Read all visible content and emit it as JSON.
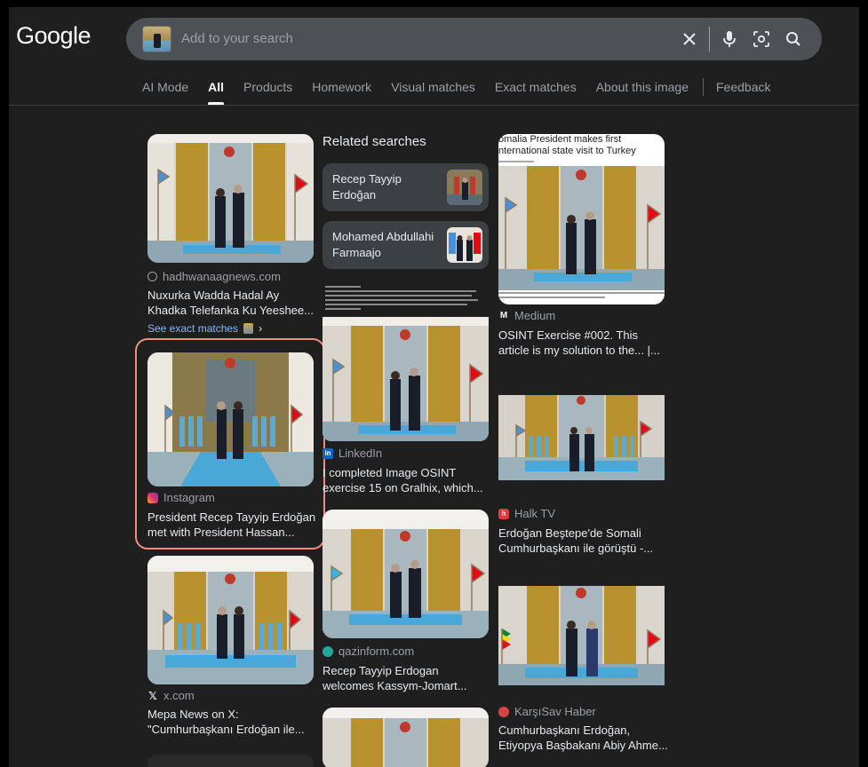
{
  "logo": "Google",
  "search": {
    "placeholder": "Add to your search"
  },
  "tabs": [
    "AI Mode",
    "All",
    "Products",
    "Homework",
    "Visual matches",
    "Exact matches",
    "About this image",
    "Feedback"
  ],
  "related": {
    "heading": "Related searches",
    "chips": [
      {
        "line1": "Recep Tayyip",
        "line2": "Erdoğan"
      },
      {
        "line1": "Mohamed Abdullahi",
        "line2": "Farmaajo"
      }
    ]
  },
  "cards": {
    "c1": {
      "site": "hadhwanaagnews.com",
      "t1": "Nuxurka Wadda Hadal Ay",
      "t2": "Khadka Telefanka Ku Yeeshee..."
    },
    "exact_matches": "See exact matches",
    "c2": {
      "site": "Instagram",
      "t1": "President Recep Tayyip Erdoğan",
      "t2": "met with President Hassan..."
    },
    "c3": {
      "site": "x.com",
      "t1": "Mepa News on X:",
      "t2": "\"Cumhurbaşkanı Erdoğan ile..."
    },
    "c4": {
      "site": "LinkedIn",
      "t1": "I completed Image OSINT",
      "t2": "exercise 15 on Gralhix, which..."
    },
    "c5": {
      "site": "qazinform.com",
      "t1": "Recep Tayyip Erdogan",
      "t2": "welcomes Kassym-Jomart..."
    },
    "c6": {
      "site": "Medium",
      "t1": "OSINT Exercise #002. This",
      "t2": "article is my solution to the... |...",
      "headline1": "omalia President makes first",
      "headline2": "nternational state visit to Turkey"
    },
    "c7": {
      "site": "Halk TV",
      "t1": "Erdoğan Beştepe'de Somali",
      "t2": "Cumhurbaşkanı ile görüştü -..."
    },
    "c8": {
      "site": "KarşıSav Haber",
      "t1": "Cumhurbaşkanı Erdoğan,",
      "t2": "Etiyopya Başbakanı Abiy Ahme..."
    }
  },
  "colors": {
    "background": "#1f1f1f",
    "link": "#8ab4f8",
    "highlight": "#f28b82",
    "carpet": "#4aa8d8",
    "gold": "#c9a65a"
  },
  "icons": [
    "clear-icon",
    "microphone-icon",
    "lens-icon",
    "search-icon",
    "globe-icon",
    "instagram-icon",
    "x-icon",
    "linkedin-icon",
    "qazinform-icon",
    "medium-icon",
    "halktv-icon",
    "karsisav-icon"
  ]
}
